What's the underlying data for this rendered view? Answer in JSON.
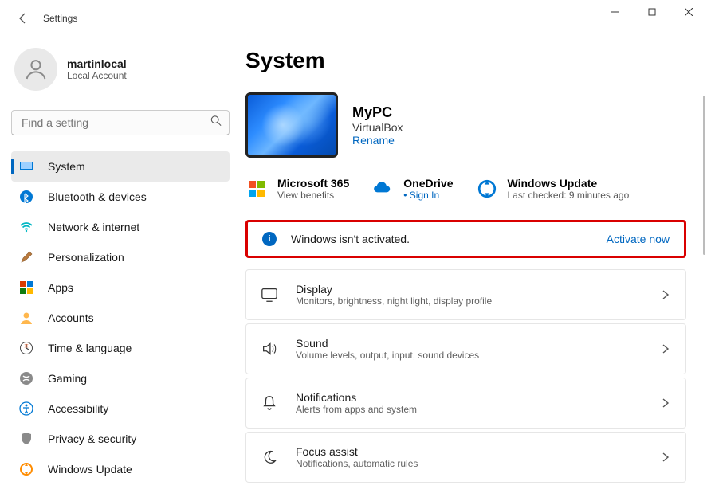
{
  "window": {
    "title": "Settings"
  },
  "user": {
    "name": "martinlocal",
    "sub": "Local Account"
  },
  "search": {
    "placeholder": "Find a setting"
  },
  "nav": [
    {
      "label": "System"
    },
    {
      "label": "Bluetooth & devices"
    },
    {
      "label": "Network & internet"
    },
    {
      "label": "Personalization"
    },
    {
      "label": "Apps"
    },
    {
      "label": "Accounts"
    },
    {
      "label": "Time & language"
    },
    {
      "label": "Gaming"
    },
    {
      "label": "Accessibility"
    },
    {
      "label": "Privacy & security"
    },
    {
      "label": "Windows Update"
    }
  ],
  "page": {
    "heading": "System"
  },
  "pc": {
    "name": "MyPC",
    "model": "VirtualBox",
    "rename": "Rename"
  },
  "quick": {
    "m365": {
      "title": "Microsoft 365",
      "sub": "View benefits"
    },
    "onedrive": {
      "title": "OneDrive",
      "sub": "Sign In"
    },
    "update": {
      "title": "Windows Update",
      "sub": "Last checked: 9 minutes ago"
    }
  },
  "banner": {
    "text": "Windows isn't activated.",
    "action": "Activate now"
  },
  "cards": {
    "display": {
      "title": "Display",
      "sub": "Monitors, brightness, night light, display profile"
    },
    "sound": {
      "title": "Sound",
      "sub": "Volume levels, output, input, sound devices"
    },
    "notif": {
      "title": "Notifications",
      "sub": "Alerts from apps and system"
    },
    "focus": {
      "title": "Focus assist",
      "sub": "Notifications, automatic rules"
    }
  }
}
